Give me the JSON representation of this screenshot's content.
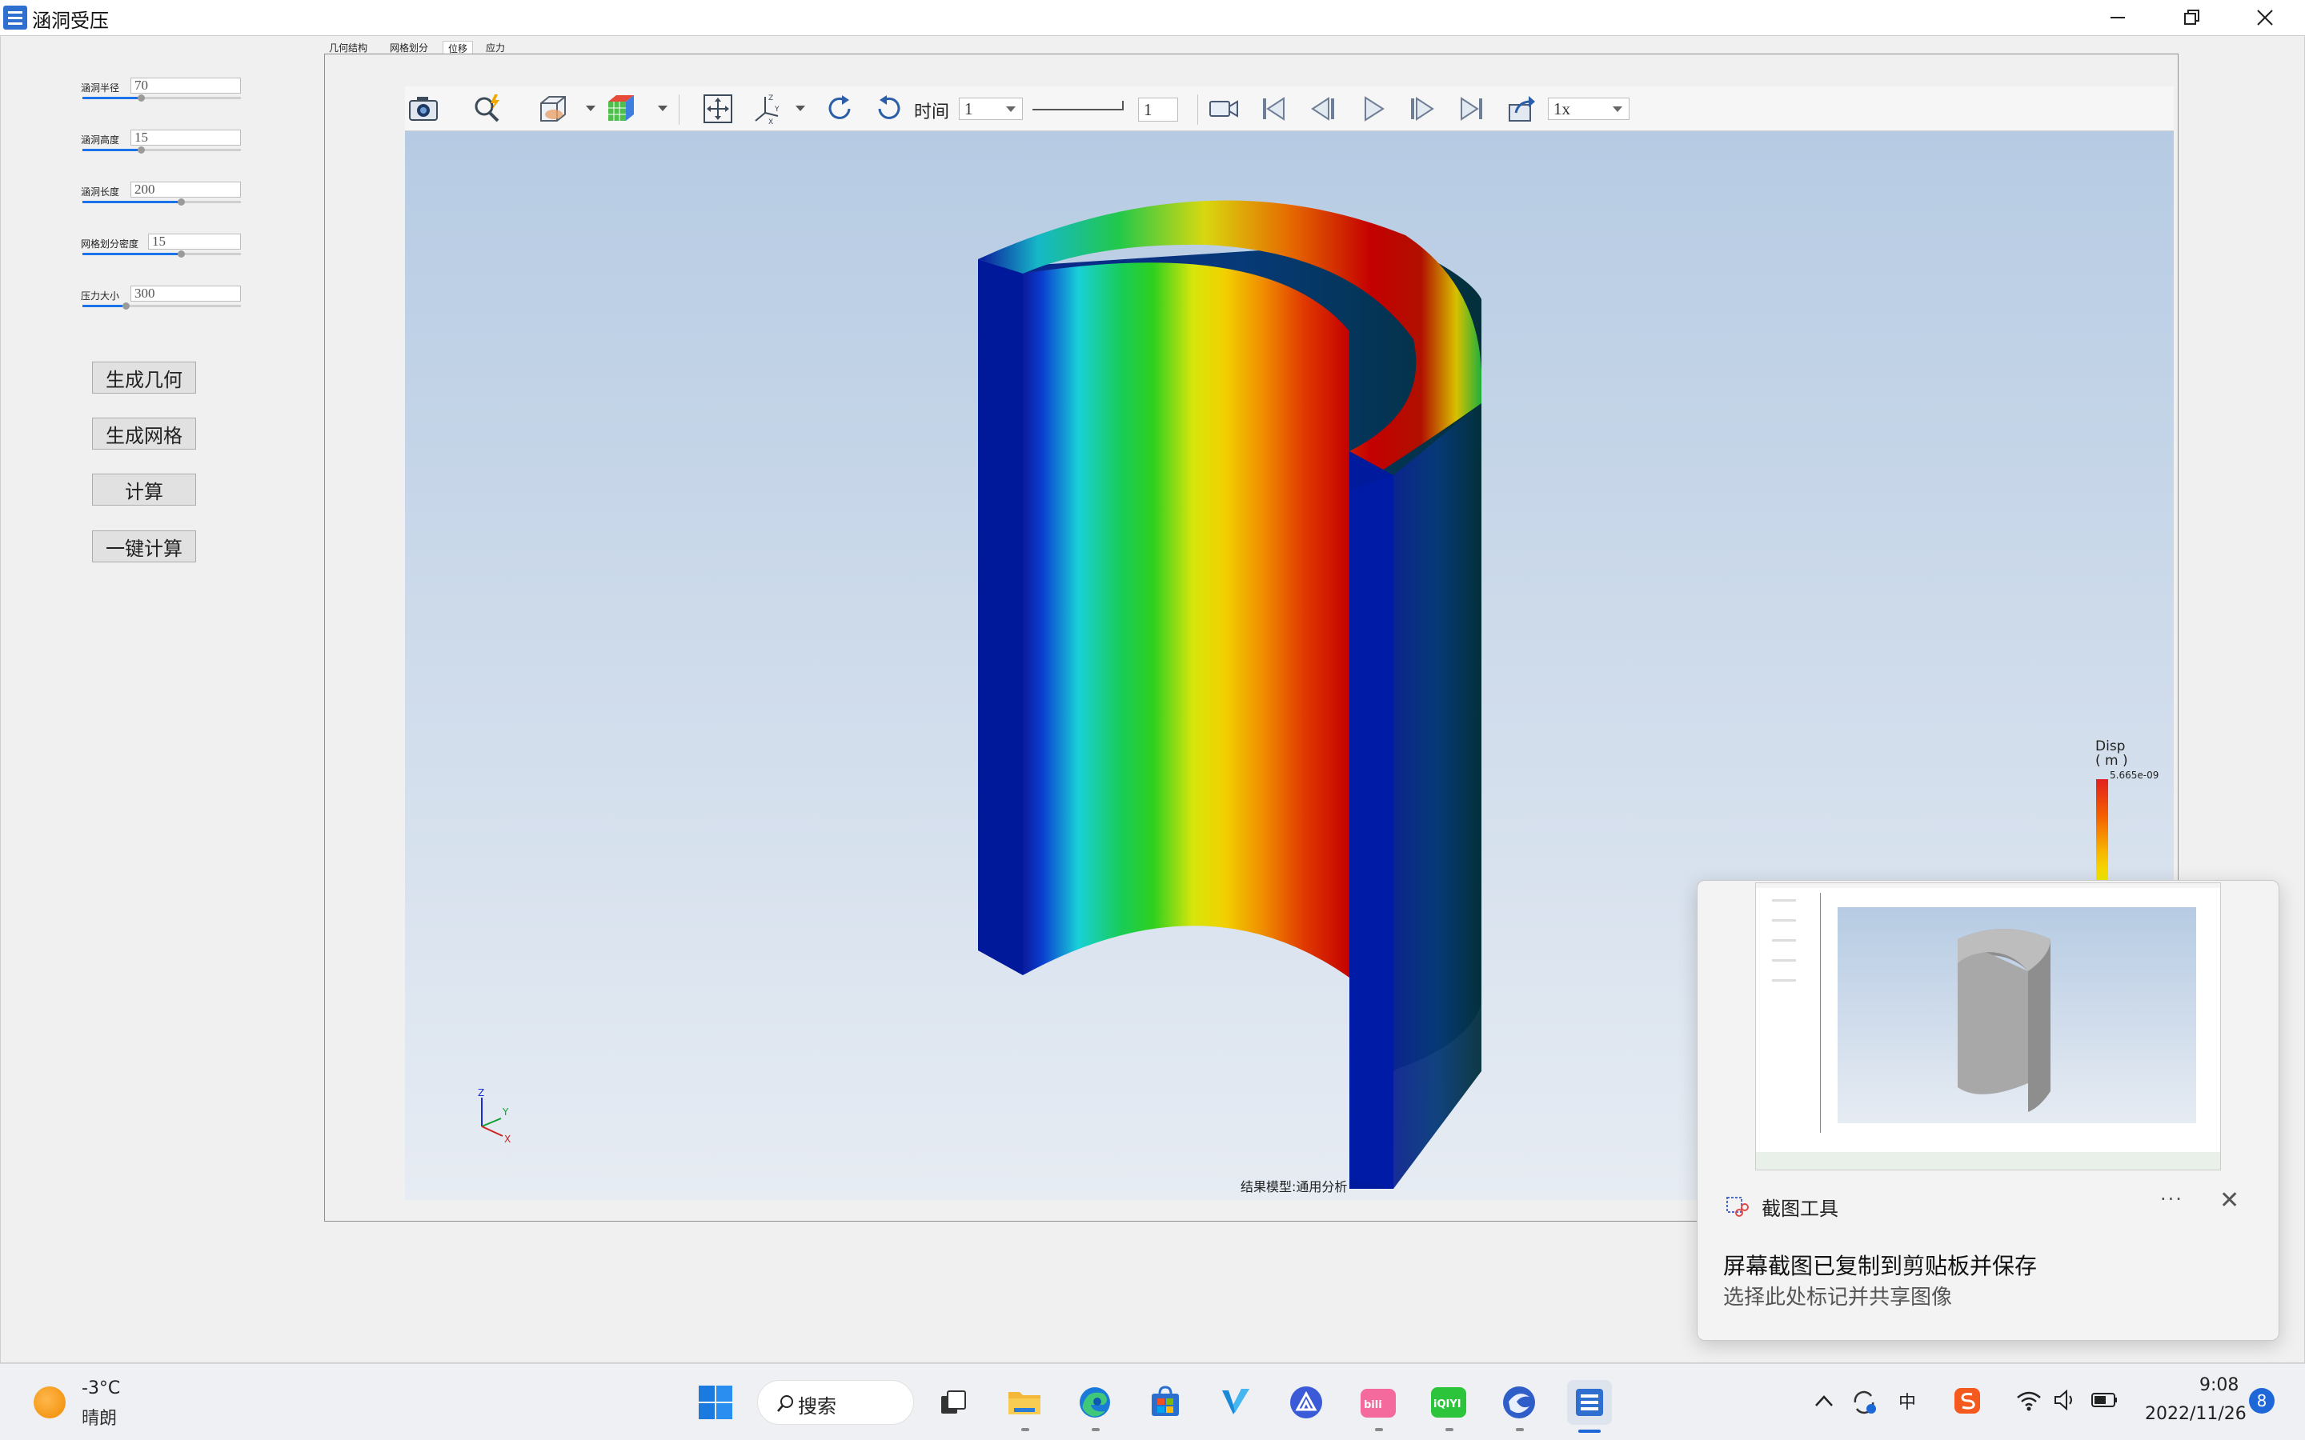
{
  "window": {
    "title": "涵洞受压",
    "controls": [
      "minimize",
      "restore",
      "close"
    ]
  },
  "params": [
    {
      "label": "涵洞半径",
      "value": "70",
      "fill": 0.35
    },
    {
      "label": "涵洞高度",
      "value": "15",
      "fill": 0.35
    },
    {
      "label": "涵洞长度",
      "value": "200",
      "fill": 0.6
    },
    {
      "label": "网格划分密度",
      "value": "15",
      "fill": 0.6
    },
    {
      "label": "压力大小",
      "value": "300",
      "fill": 0.25
    }
  ],
  "buttons": {
    "generate_geometry": "生成几何",
    "generate_mesh": "生成网格",
    "compute": "计算",
    "one_click_compute": "一键计算"
  },
  "tabs": [
    {
      "label": "几何结构",
      "active": false
    },
    {
      "label": "网格划分",
      "active": false
    },
    {
      "label": "位移",
      "active": true
    },
    {
      "label": "应力",
      "active": false
    }
  ],
  "toolbar": {
    "icons": [
      "camera-icon",
      "zoom-magnifier-icon",
      "clip-box-icon",
      "color-map-cube-icon",
      "fit-view-icon",
      "axes-icon",
      "rotate-cw-icon",
      "rotate-ccw-icon",
      "video-record-icon",
      "first-frame-icon",
      "prev-frame-icon",
      "play-icon",
      "next-frame-icon",
      "last-frame-icon",
      "export-icon"
    ],
    "time_label": "时间",
    "time_value": "1",
    "frame_value": "1",
    "speed_value": "1x"
  },
  "viewport": {
    "model_label": "结果模型:通用分析",
    "legend_title": "Disp",
    "legend_unit": "( m )",
    "legend_max": "5.665e-09"
  },
  "notification": {
    "app": "截图工具",
    "headline": "屏幕截图已复制到剪贴板并保存",
    "body": "选择此处标记并共享图像",
    "more": "···",
    "close": "✕"
  },
  "taskbar": {
    "weather_temp": "-3°C",
    "weather_desc": "晴朗",
    "search_label": "搜索",
    "apps": [
      "windows-start-icon",
      "task-view-icon",
      "file-explorer-icon",
      "edge-icon",
      "store-icon",
      "vcode-icon",
      "app-a-icon",
      "bilibili-icon",
      "iqiyi-icon",
      "swirl-app-icon",
      "culvert-app-icon"
    ],
    "ime_label": "中",
    "time": "9:08",
    "date": "2022/11/26",
    "notification_count": "8"
  },
  "colors": {
    "accent": "#1a73e8",
    "viewport_top": "#b6cbe3",
    "viewport_bottom": "#e7ecf3",
    "displacement_max": "#d40000",
    "displacement_min": "#00189a"
  }
}
